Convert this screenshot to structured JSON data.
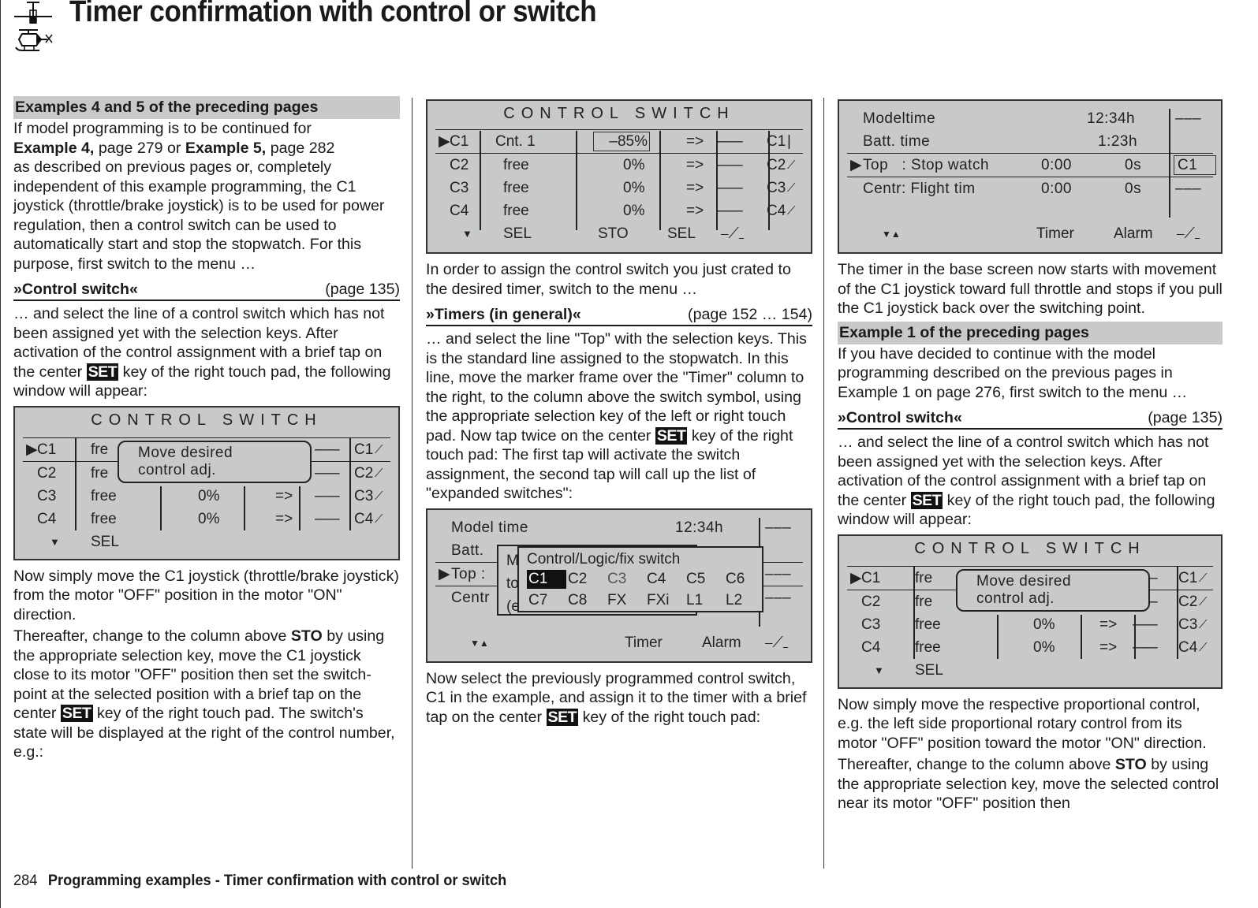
{
  "header": {
    "title": "Timer confirmation with control or switch",
    "icon": "helicopter-and-glider-icon"
  },
  "footer": {
    "page_number": "284",
    "text": "Programming examples - Timer confirmation with control or switch"
  },
  "col1": {
    "section_header": "Examples 4 and 5 of the preceding pages",
    "p1_a": "If model programming is to be continued for",
    "p1_ex4": "Example 4,",
    "p1_b": " page 279 or ",
    "p1_ex5": "Example 5,",
    "p1_c": " page 282",
    "p1_d": "as described on previous pages or, completely independent of this example programming, the C1 joystick (throttle/brake joystick) is to be used for power regulation, then a control switch can be used to automatically start and stop the stopwatch. For this purpose, first switch to the menu …",
    "menu_name": "»Control switch«",
    "menu_page": "(page 135)",
    "p2_a": "… and select the line of a control switch which has not been assigned yet with the selection keys. After activation of the control assignment with a brief tap on the center ",
    "set_key": "SET",
    "p2_b": " key of the right touch pad, the following window will appear:",
    "p3": "Now simply move the C1 joystick (throttle/brake joystick) from the motor \"OFF\" position in the motor \"ON\" direction.",
    "p4_a": "Thereafter, change to the column above ",
    "p4_sto": "STO",
    "p4_b": " by using the appropriate selection key, move the C1 joystick close to its motor \"OFF\" position then set the switch-point at the selected position with a brief tap on the center ",
    "p4_c": " key of the right touch pad. The switch's state will be displayed at the right of the control number, e.g.:"
  },
  "lcd1": {
    "title": "CONTROL SWITCH",
    "rows": [
      {
        "id": "C1",
        "ctrl": "fre",
        "val": "",
        "arrow": "",
        "sw": "–––",
        "state": "C1"
      },
      {
        "id": "C2",
        "ctrl": "fre",
        "val": "",
        "arrow": "",
        "sw": "–––",
        "state": "C2"
      },
      {
        "id": "C3",
        "ctrl": "free",
        "val": "0%",
        "arrow": "=>",
        "sw": "–––",
        "state": "C3"
      },
      {
        "id": "C4",
        "ctrl": "free",
        "val": "0%",
        "arrow": "=>",
        "sw": "–––",
        "state": "C4"
      }
    ],
    "popup_line1": "Move desired",
    "popup_line2": "control adj.",
    "softkey": "SEL"
  },
  "col2": {
    "p1": "In order to assign the control switch you just crated to the desired timer, switch to the menu …",
    "menu_name": "»Timers (in general)«",
    "menu_page": "(page 152 … 154)",
    "p2_a": "… and select the line \"Top\" with the selection keys. This is the standard line assigned to the stopwatch. In this line, move the marker frame over the \"Timer\" column to the right, to the column above the switch symbol, using the appropriate selection key of the left or right touch pad. Now tap twice on the center ",
    "set_key": "SET",
    "p2_b": " key of the right touch pad: The first tap will activate the switch assignment, the second tap will call up the list of \"expanded switches\":",
    "p3_a": "Now select the previously programmed control switch, C1 in the example, and assign it to the timer with a brief tap on the center ",
    "p3_b": " key of the right touch pad:"
  },
  "lcd2": {
    "title": "CONTROL SWITCH",
    "rows": [
      {
        "id": "C1",
        "ctrl": "Cnt. 1",
        "val": "–85%",
        "arrow": "=>",
        "sw": "–––",
        "state": "C1"
      },
      {
        "id": "C2",
        "ctrl": "free",
        "val": "0%",
        "arrow": "=>",
        "sw": "–––",
        "state": "C2"
      },
      {
        "id": "C3",
        "ctrl": "free",
        "val": "0%",
        "arrow": "=>",
        "sw": "–––",
        "state": "C3"
      },
      {
        "id": "C4",
        "ctrl": "free",
        "val": "0%",
        "arrow": "=>",
        "sw": "–––",
        "state": "C4"
      }
    ],
    "softkeys": [
      "SEL",
      "STO",
      "SEL"
    ]
  },
  "lcd3": {
    "rows": [
      {
        "label": "Model time",
        "time": "12:34h",
        "sw": "–––"
      },
      {
        "label": "Batt.",
        "time": "",
        "sw": ""
      },
      {
        "label": "Top  :",
        "time": "",
        "sw": "–––"
      },
      {
        "label": "Centr",
        "time": "",
        "sw": "–––"
      }
    ],
    "under_popup": [
      "M",
      "to",
      "(e"
    ],
    "popup_title": "Control/Logic/fix switch",
    "switches_row1": [
      "C1",
      "C2",
      "C3",
      "C4",
      "C5",
      "C6"
    ],
    "switches_row2": [
      "C7",
      "C8",
      "FX",
      "FXi",
      "L1",
      "L2"
    ],
    "selected_switch": "C1",
    "softkeys": [
      "Timer",
      "Alarm"
    ]
  },
  "lcd4": {
    "rows": [
      {
        "label": "Modeltime",
        "mid": "",
        "time": "12:34h",
        "sw": "–––"
      },
      {
        "label": "Batt. time",
        "mid": "",
        "time": "1:23h",
        "sw": ""
      },
      {
        "label": "Top   : Stop watch",
        "mid": "0:00",
        "time": "0s",
        "sw": "C1"
      },
      {
        "label": "Centr: Flight tim",
        "mid": "0:00",
        "time": "0s",
        "sw": "–––"
      }
    ],
    "softkeys": [
      "Timer",
      "Alarm"
    ]
  },
  "col3": {
    "p1": "The timer in the base screen now starts with movement of the C1 joystick toward full throttle and stops if you pull the C1 joystick back over the switching point.",
    "section_header": "Example 1 of the preceding pages",
    "p2": "If you have decided to continue with the model programming described on the previous pages in Example 1 on page 276, first switch to the menu …",
    "menu_name": "»Control switch«",
    "menu_page": "(page 135)",
    "p3_a": "… and select the line of a control switch which has not been assigned yet with the selection keys. After activation of the control assignment with a brief tap on the center ",
    "set_key": "SET",
    "p3_b": " key of the right touch pad, the following window will appear:",
    "p4": "Now simply move the respective proportional control, e.g. the left side proportional rotary control from its motor \"OFF\" position toward the motor \"ON\" direction.",
    "p5_a": "Thereafter, change to the column above ",
    "p5_sto": "STO",
    "p5_b": " by using the appropriate selection key, move the selected control near its motor \"OFF\" position then"
  },
  "lcd5": {
    "title": "CONTROL SWITCH",
    "rows": [
      {
        "id": "C1",
        "ctrl": "fre",
        "val": "",
        "arrow": "",
        "sw": "–––",
        "state": "C1"
      },
      {
        "id": "C2",
        "ctrl": "fre",
        "val": "",
        "arrow": "",
        "sw": "–––",
        "state": "C2"
      },
      {
        "id": "C3",
        "ctrl": "free",
        "val": "0%",
        "arrow": "=>",
        "sw": "–––",
        "state": "C3"
      },
      {
        "id": "C4",
        "ctrl": "free",
        "val": "0%",
        "arrow": "=>",
        "sw": "–––",
        "state": "C4"
      }
    ],
    "popup_line1": "Move desired",
    "popup_line2": "control adj.",
    "softkey": "SEL"
  }
}
